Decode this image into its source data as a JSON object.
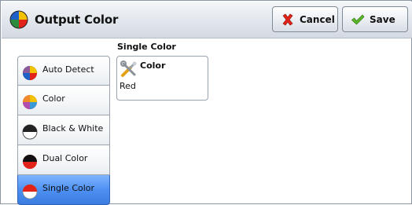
{
  "window": {
    "title": "Output Color",
    "title_icon": "color-wheel-icon"
  },
  "toolbar": {
    "cancel": {
      "label": "Cancel",
      "icon": "red-x-icon",
      "color": "#e2231a"
    },
    "save": {
      "label": "Save",
      "icon": "green-check-icon",
      "color": "#5cb82a"
    }
  },
  "options": [
    {
      "label": "Auto Detect",
      "icon": "auto-detect-icon",
      "selected": false
    },
    {
      "label": "Color",
      "icon": "color-wheel-icon",
      "selected": false
    },
    {
      "label": "Black & White",
      "icon": "black-white-icon",
      "selected": false
    },
    {
      "label": "Dual Color",
      "icon": "dual-color-icon",
      "selected": false
    },
    {
      "label": "Single Color",
      "icon": "single-color-icon",
      "selected": true
    }
  ],
  "single_color": {
    "section_label": "Single Color",
    "tile": {
      "label": "Color",
      "value": "Red",
      "icon": "tools-icon"
    }
  },
  "colors": {
    "selection": "#4e90f2",
    "header": "#dfe4ea"
  }
}
